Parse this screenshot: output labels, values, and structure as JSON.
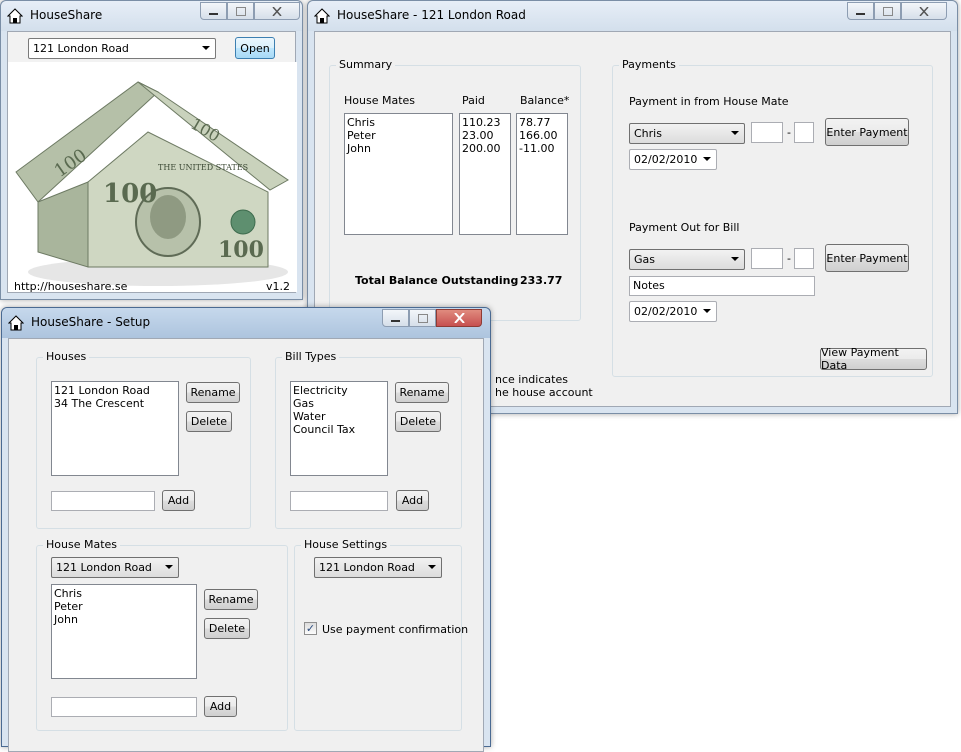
{
  "window_small": {
    "title": "HouseShare",
    "house_select": "121 London Road",
    "open_label": "Open",
    "url": "http://houseshare.se",
    "version": "v1.2"
  },
  "window_main": {
    "title": "HouseShare - 121 London Road",
    "summary": {
      "group_label": "Summary",
      "col_housemates": "House Mates",
      "col_paid": "Paid",
      "col_balance": "Balance*",
      "housemates": [
        "Chris",
        "Peter",
        "John"
      ],
      "paid": [
        "110.23",
        "23.00",
        "200.00"
      ],
      "balance": [
        "78.77",
        "166.00",
        "-11.00"
      ],
      "total_label": "Total Balance Outstanding",
      "total_value": "233.77",
      "footnote_line1": "nce indicates",
      "footnote_line2": "he house account"
    },
    "payments": {
      "group_label": "Payments",
      "in_label": "Payment in from House Mate",
      "in_person": "Chris",
      "in_amount_whole": "",
      "in_dash": "-",
      "in_amount_cents": "",
      "in_button": "Enter Payment",
      "in_date": "02/02/2010",
      "out_label": "Payment Out for Bill",
      "out_bill": "Gas",
      "out_amount_whole": "",
      "out_dash": "-",
      "out_amount_cents": "",
      "out_button": "Enter Payment",
      "notes_placeholder": "Notes",
      "out_date": "02/02/2010",
      "view_button": "View Payment Data"
    }
  },
  "window_setup": {
    "title": "HouseShare - Setup",
    "houses": {
      "group_label": "Houses",
      "items": [
        "121 London Road",
        "34 The Crescent"
      ],
      "rename": "Rename",
      "delete": "Delete",
      "add": "Add",
      "new_value": ""
    },
    "bill_types": {
      "group_label": "Bill Types",
      "items": [
        "Electricity",
        "Gas",
        "Water",
        "Council Tax"
      ],
      "rename": "Rename",
      "delete": "Delete",
      "add": "Add",
      "new_value": ""
    },
    "house_mates": {
      "group_label": "House Mates",
      "house_select": "121 London Road",
      "items": [
        "Chris",
        "Peter",
        "John"
      ],
      "rename": "Rename",
      "delete": "Delete",
      "add": "Add",
      "new_value": ""
    },
    "house_settings": {
      "group_label": "House Settings",
      "house_select": "121 London Road",
      "confirm_checked": true,
      "confirm_label": "Use payment confirmation"
    }
  },
  "colors": {
    "title_bg": "#d9e4f0",
    "client_bg": "#f0f0f0",
    "close_red": "#c75050",
    "checkmark": "#2b4b7e"
  },
  "icons": [
    "house-icon",
    "minimize-icon",
    "maximize-icon",
    "close-icon",
    "dropdown-arrow-icon",
    "checkmark-icon"
  ]
}
